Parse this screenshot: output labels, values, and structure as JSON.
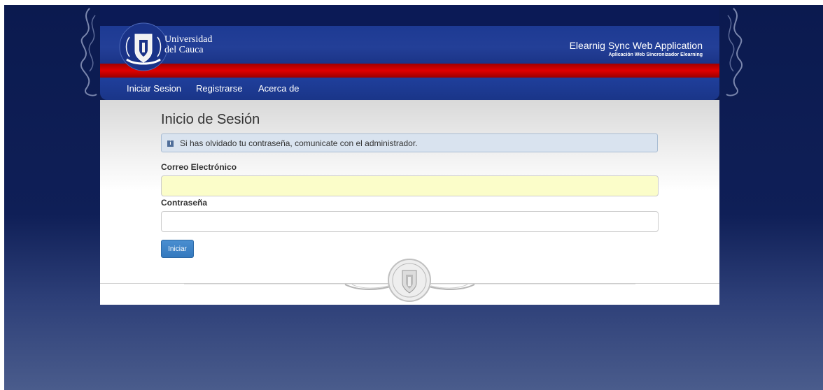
{
  "header": {
    "logo_line1": "Universidad",
    "logo_line2": "del Cauca",
    "app_title": "Elearnig Sync Web Application",
    "app_subtitle": "Aplicación Web Sincronizador Elearning"
  },
  "nav": {
    "items": [
      {
        "label": "Iniciar Sesion"
      },
      {
        "label": "Registrarse"
      },
      {
        "label": "Acerca de"
      }
    ]
  },
  "login": {
    "title": "Inicio de Sesión",
    "alert": "Si has olvidado tu contraseña, comunicate con el administrador.",
    "email_label": "Correo Electrónico",
    "email_value": "",
    "password_label": "Contraseña",
    "password_value": "",
    "submit_label": "Iniciar"
  },
  "colors": {
    "background": "#0f1f57",
    "header_blue": "#233f97",
    "red_band": "#e00000",
    "button_blue": "#3f84c8",
    "autofill_yellow": "#fbfdc9"
  },
  "icons": {
    "alert": "info-icon",
    "logo": "university-crest-icon",
    "footer": "university-seal-icon",
    "ornaments": "baroque-ornament-icon"
  }
}
